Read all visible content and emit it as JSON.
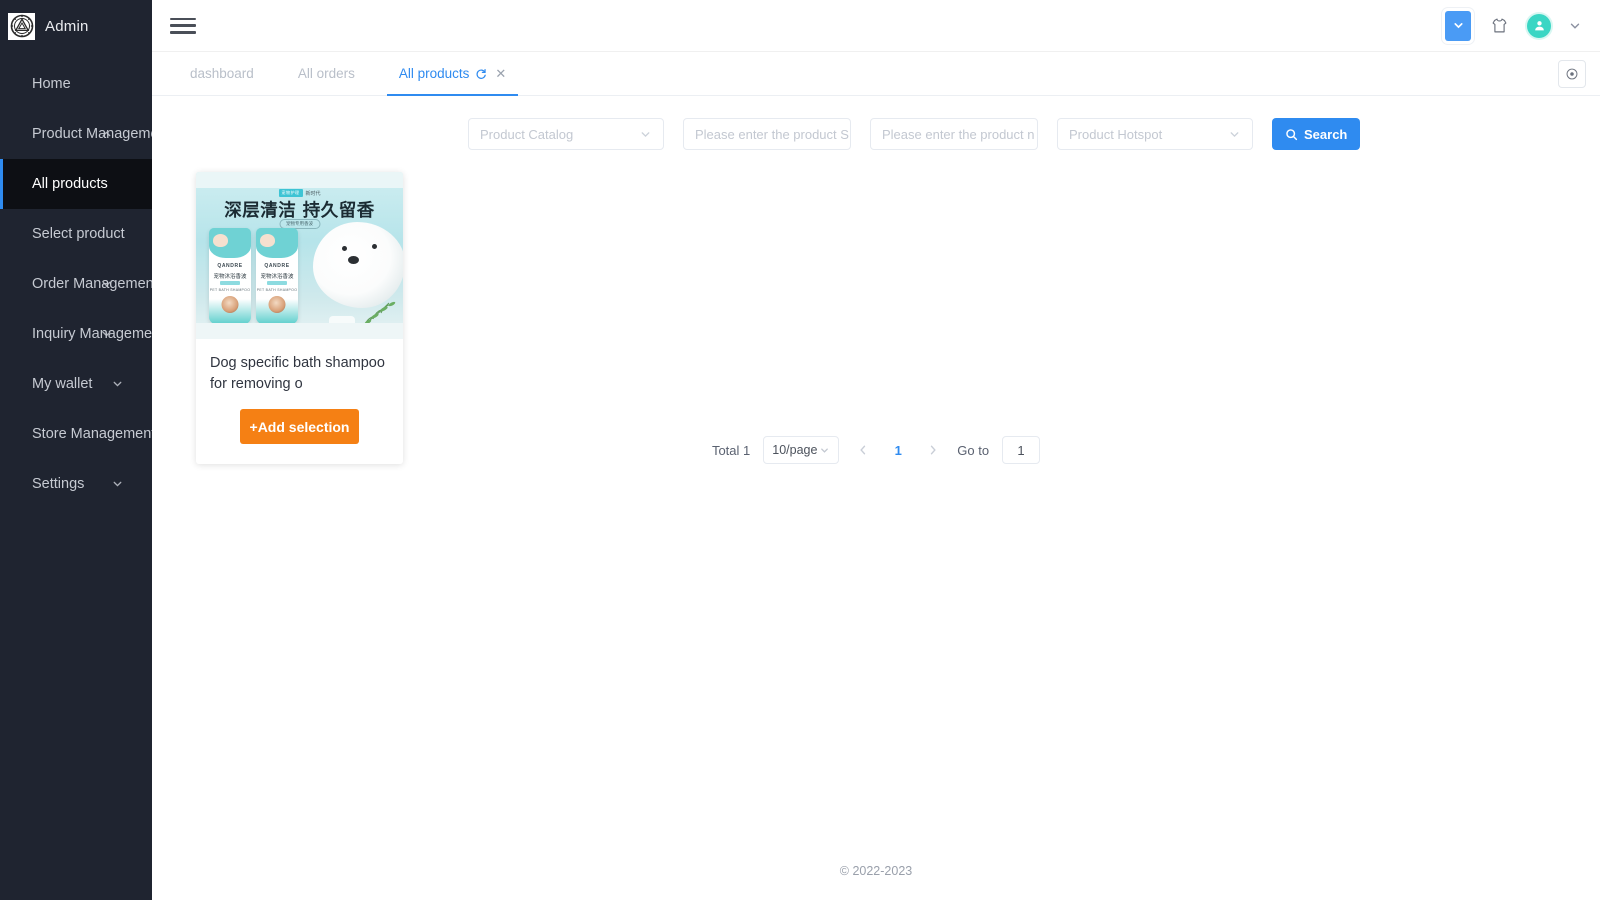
{
  "sidebar": {
    "brand": "Admin",
    "brand_logo_icon": "emblem-logo-icon",
    "items": [
      {
        "label": "Home",
        "active": false,
        "chevron": null
      },
      {
        "label": "Product Management",
        "active": false,
        "chevron": "chevron-up-icon"
      },
      {
        "label": "All products",
        "active": true,
        "chevron": null
      },
      {
        "label": "Select product",
        "active": false,
        "chevron": null
      },
      {
        "label": "Order Management",
        "active": false,
        "chevron": "chevron-down-icon"
      },
      {
        "label": "Inquiry Management",
        "active": false,
        "chevron": "chevron-down-icon"
      },
      {
        "label": "My wallet",
        "active": false,
        "chevron": "chevron-down-icon"
      },
      {
        "label": "Store Management",
        "active": false,
        "chevron": null
      },
      {
        "label": "Settings",
        "active": false,
        "chevron": "chevron-down-icon"
      }
    ]
  },
  "topbar": {
    "menu_icon": "hamburger-icon",
    "blue_box_icon": "chevron-down-icon",
    "shirt_icon": "t-shirt-icon",
    "avatar_icon": "user-avatar-icon",
    "caret_icon": "chevron-down-icon"
  },
  "tabs": {
    "items": [
      {
        "label": "dashboard",
        "active": false
      },
      {
        "label": "All orders",
        "active": false
      },
      {
        "label": "All products",
        "active": true
      }
    ],
    "refresh_icon": "refresh-icon",
    "close_icon": "close-icon",
    "settings_icon": "settings-gear-icon"
  },
  "filters": {
    "catalog_placeholder": "Product Catalog",
    "sku_placeholder": "Please enter the product SI",
    "name_placeholder": "Please enter the product n",
    "hotspot_placeholder": "Product Hotspot",
    "search_label": "Search",
    "search_icon": "search-icon",
    "chevron_icon": "chevron-down-icon",
    "accent_color": "#2f8bf0"
  },
  "products": [
    {
      "title": "Dog specific bath shampoo for removing o",
      "button_label": "+Add selection",
      "button_color": "#f58014",
      "image": {
        "tag_badge": "宠物护理",
        "tag_text": "新时代",
        "headline": "深层清洁 持久留香",
        "subline": "宠物专用香波",
        "bottle_brand": "QANDRE",
        "bottle_cn": "宠物沐浴香波",
        "bottle_en": "PET BATH SHAMPOO"
      }
    }
  ],
  "pagination": {
    "total_label": "Total 1",
    "page_size": "10/page",
    "prev_icon": "chevron-left-icon",
    "next_icon": "chevron-right-icon",
    "current_page": "1",
    "goto_label": "Go to",
    "goto_value": "1"
  },
  "footer": {
    "copyright": "© 2022-2023"
  }
}
